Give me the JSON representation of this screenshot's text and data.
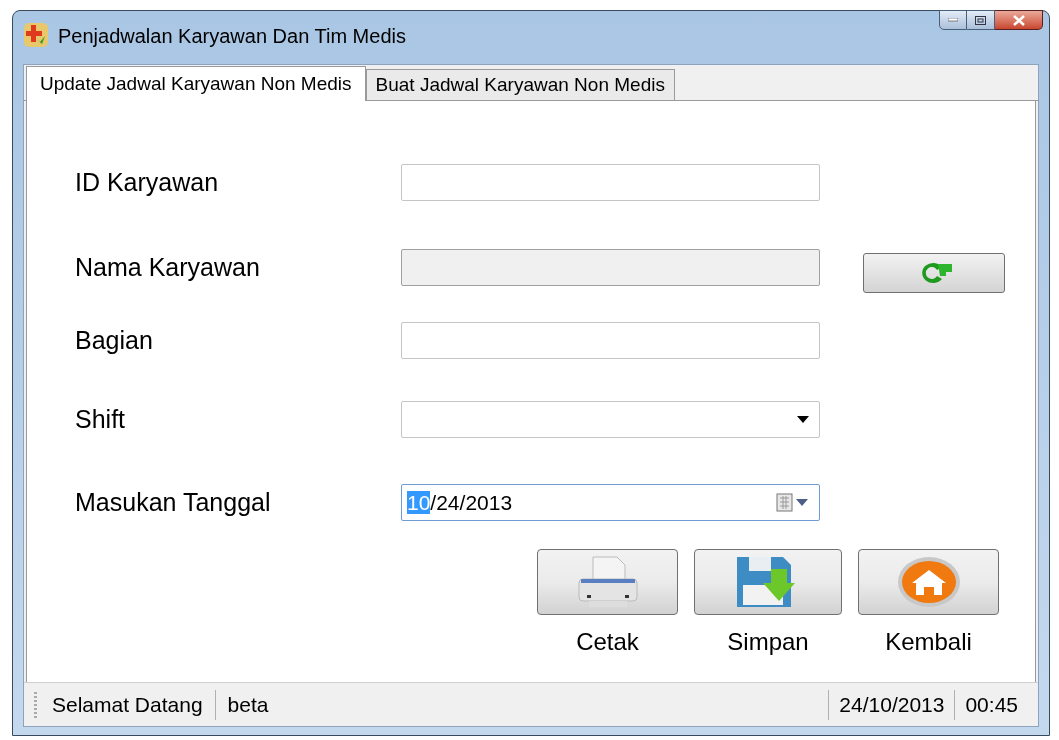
{
  "window": {
    "title": "Penjadwalan Karyawan Dan Tim Medis"
  },
  "tabs": [
    {
      "label": "Update Jadwal Karyawan Non Medis",
      "selected": true
    },
    {
      "label": "Buat Jadwal Karyawan Non Medis",
      "selected": false
    }
  ],
  "fields": [
    {
      "label": "ID Karyawan",
      "kind": "text"
    },
    {
      "label": "Nama Karyawan",
      "kind": "readonly",
      "refresh_button": true
    },
    {
      "label": "Bagian",
      "kind": "text"
    },
    {
      "label": "Shift",
      "kind": "combo"
    },
    {
      "label": "Masukan Tanggal",
      "kind": "date",
      "value_parts": [
        {
          "text": "10",
          "selected": true
        },
        {
          "text": "/24/2013",
          "selected": false
        }
      ]
    }
  ],
  "action_buttons": [
    {
      "label": "Cetak"
    },
    {
      "label": "Simpan"
    },
    {
      "label": "Kembali"
    }
  ],
  "status_bar": {
    "left": [
      "Selamat Datang",
      "beta"
    ],
    "right": [
      "24/10/2013",
      "00:45"
    ]
  }
}
